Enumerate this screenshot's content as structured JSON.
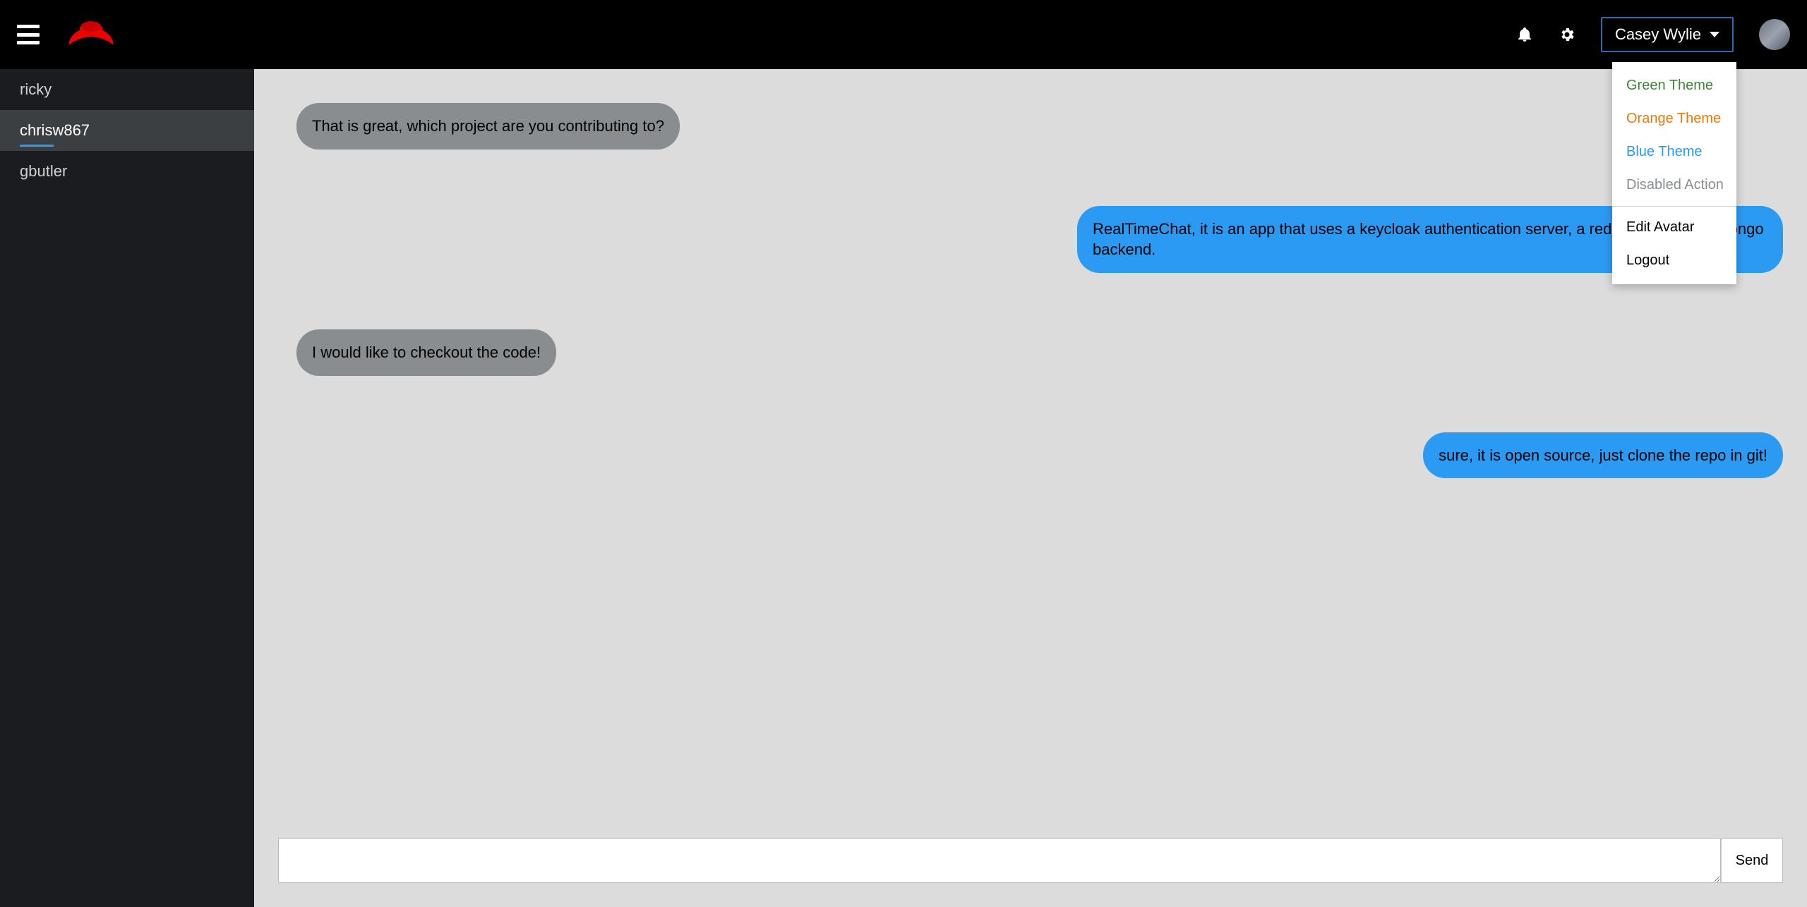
{
  "header": {
    "user_name": "Casey Wylie"
  },
  "dropdown": {
    "items": [
      {
        "label": "Green Theme",
        "cls": "green",
        "interact": true
      },
      {
        "label": "Orange Theme",
        "cls": "orange",
        "interact": true
      },
      {
        "label": "Blue Theme",
        "cls": "blue",
        "interact": true
      },
      {
        "label": "Disabled Action",
        "cls": "disabled",
        "interact": false
      },
      {
        "sep": true
      },
      {
        "label": "Edit Avatar",
        "cls": "",
        "interact": true
      },
      {
        "label": "Logout",
        "cls": "",
        "interact": true
      }
    ]
  },
  "sidebar": {
    "contacts": [
      {
        "name": "ricky",
        "active": false
      },
      {
        "name": "chrisw867",
        "active": true
      },
      {
        "name": "gbutler",
        "active": false
      }
    ]
  },
  "chat": {
    "messages": [
      {
        "side": "left",
        "text": "That is great, which project are you contributing to?"
      },
      {
        "side": "right",
        "text": "RealTimeChat, it is an app that uses a keycloak authentication server, a redis cache and a mongo backend."
      },
      {
        "side": "left",
        "text": "I would like to checkout the code!"
      },
      {
        "side": "right",
        "text": "sure, it is open source, just clone the repo in git!"
      }
    ]
  },
  "composer": {
    "placeholder": "",
    "value": "",
    "send_label": "Send"
  }
}
